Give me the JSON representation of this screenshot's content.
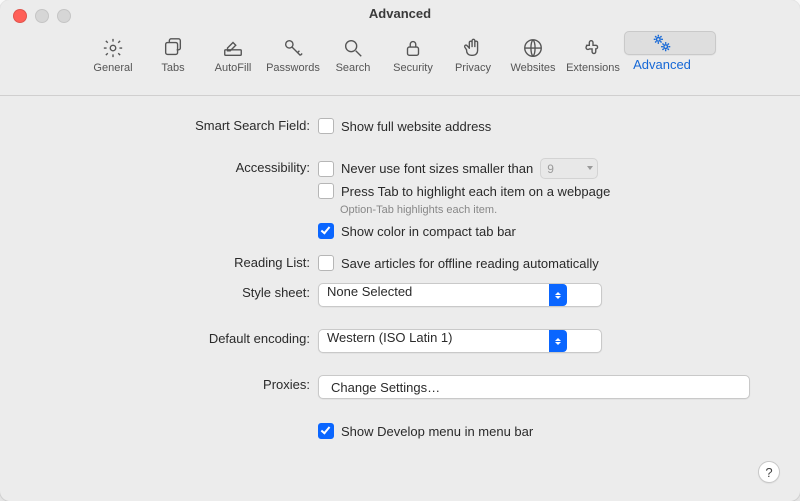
{
  "window": {
    "title": "Advanced"
  },
  "toolbar": {
    "items": [
      {
        "label": "General",
        "icon": "gear-icon"
      },
      {
        "label": "Tabs",
        "icon": "tabs-icon"
      },
      {
        "label": "AutoFill",
        "icon": "pencil-field-icon"
      },
      {
        "label": "Passwords",
        "icon": "key-icon"
      },
      {
        "label": "Search",
        "icon": "magnifier-icon"
      },
      {
        "label": "Security",
        "icon": "lock-icon"
      },
      {
        "label": "Privacy",
        "icon": "hand-icon"
      },
      {
        "label": "Websites",
        "icon": "globe-icon"
      },
      {
        "label": "Extensions",
        "icon": "puzzle-icon"
      },
      {
        "label": "Advanced",
        "icon": "gears-icon"
      }
    ],
    "selected_index": 9
  },
  "sections": {
    "smart_search": {
      "label": "Smart Search Field:",
      "show_full_address": {
        "text": "Show full website address",
        "checked": false
      }
    },
    "accessibility": {
      "label": "Accessibility:",
      "min_font": {
        "text": "Never use font sizes smaller than",
        "checked": false,
        "value": "9"
      },
      "tab_highlight": {
        "text": "Press Tab to highlight each item on a webpage",
        "checked": false,
        "hint": "Option-Tab highlights each item."
      },
      "compact_color": {
        "text": "Show color in compact tab bar",
        "checked": true
      }
    },
    "reading_list": {
      "label": "Reading List:",
      "offline": {
        "text": "Save articles for offline reading automatically",
        "checked": false
      }
    },
    "stylesheet": {
      "label": "Style sheet:",
      "value": "None Selected"
    },
    "encoding": {
      "label": "Default encoding:",
      "value": "Western (ISO Latin 1)"
    },
    "proxies": {
      "label": "Proxies:",
      "button": "Change Settings…"
    },
    "develop": {
      "text": "Show Develop menu in menu bar",
      "checked": true
    }
  },
  "help": "?"
}
